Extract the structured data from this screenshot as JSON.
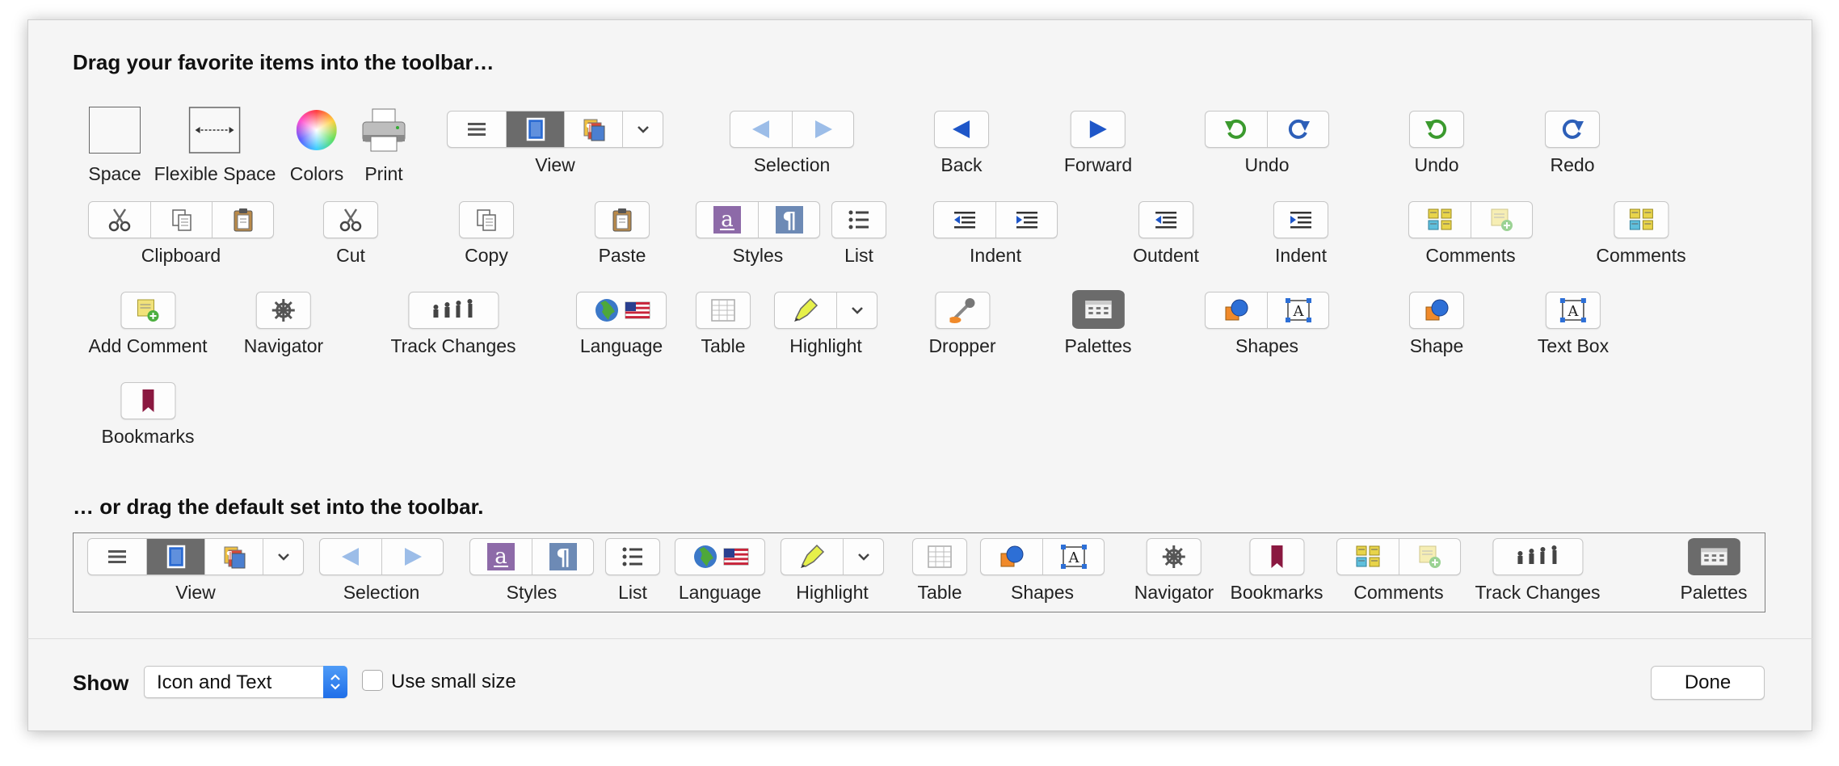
{
  "headings": {
    "favorites": "Drag your favorite items into the toolbar…",
    "defaults": "… or drag the default set into the toolbar."
  },
  "items": [
    {
      "label": "Space"
    },
    {
      "label": "Flexible Space"
    },
    {
      "label": "Colors"
    },
    {
      "label": "Print"
    },
    {
      "label": "View"
    },
    {
      "label": "Selection"
    },
    {
      "label": "Back"
    },
    {
      "label": "Forward"
    },
    {
      "label": "Undo"
    },
    {
      "label": "Undo"
    },
    {
      "label": "Redo"
    },
    {
      "label": "Clipboard"
    },
    {
      "label": "Cut"
    },
    {
      "label": "Copy"
    },
    {
      "label": "Paste"
    },
    {
      "label": "Styles"
    },
    {
      "label": "List"
    },
    {
      "label": "Indent"
    },
    {
      "label": "Outdent"
    },
    {
      "label": "Indent"
    },
    {
      "label": "Comments"
    },
    {
      "label": "Comments"
    },
    {
      "label": "Add Comment"
    },
    {
      "label": "Navigator"
    },
    {
      "label": "Track Changes"
    },
    {
      "label": "Language"
    },
    {
      "label": "Table"
    },
    {
      "label": "Highlight"
    },
    {
      "label": "Dropper"
    },
    {
      "label": "Palettes"
    },
    {
      "label": "Shapes"
    },
    {
      "label": "Shape"
    },
    {
      "label": "Text Box"
    },
    {
      "label": "Bookmarks"
    }
  ],
  "default_set": [
    {
      "label": "View"
    },
    {
      "label": "Selection"
    },
    {
      "label": "Styles"
    },
    {
      "label": "List"
    },
    {
      "label": "Language"
    },
    {
      "label": "Highlight"
    },
    {
      "label": "Table"
    },
    {
      "label": "Shapes"
    },
    {
      "label": "Navigator"
    },
    {
      "label": "Bookmarks"
    },
    {
      "label": "Comments"
    },
    {
      "label": "Track Changes"
    },
    {
      "label": "Palettes"
    }
  ],
  "footer": {
    "show_label": "Show",
    "show_value": "Icon and Text",
    "small_size_label": "Use small size",
    "small_size_checked": false,
    "done_label": "Done"
  },
  "colors": {
    "accent_blue": "#2d6fd6",
    "undo_green": "#3b9a2e",
    "styles_purple": "#8d6aa8",
    "styles_slate": "#6d8ab5",
    "bookmark_red": "#8a1840"
  }
}
